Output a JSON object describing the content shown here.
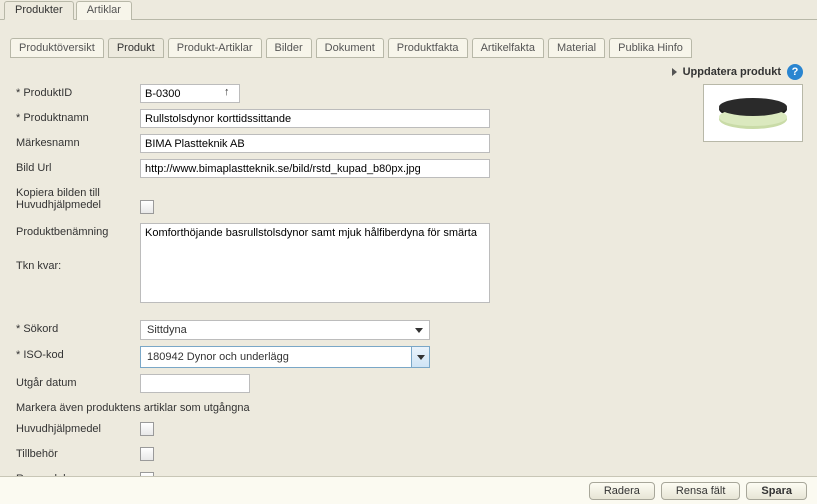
{
  "top_tabs": {
    "produkter": "Produkter",
    "artiklar": "Artiklar"
  },
  "sub_tabs": {
    "oversikt": "Produktöversikt",
    "produkt": "Produkt",
    "produkt_artiklar": "Produkt-Artiklar",
    "bilder": "Bilder",
    "dokument": "Dokument",
    "produktfakta": "Produktfakta",
    "artikelfakta": "Artikelfakta",
    "material": "Material",
    "publika_hinfo": "Publika Hinfo"
  },
  "uppdatera": "Uppdatera produkt",
  "labels": {
    "produktID": "ProduktID",
    "produktnamn": "Produktnamn",
    "markesnamn": "Märkesnamn",
    "bild_url": "Bild Url",
    "kopiera": "Kopiera bilden till Huvudhjälpmedel",
    "produktbenamning": "Produktbenämning",
    "tkn_kvar": "Tkn kvar:",
    "sokord": "Sökord",
    "iso_kod": "ISO-kod",
    "utgar_datum": "Utgår datum",
    "markera": "Markera även produktens artiklar som utgångna",
    "huvudhjalpmedel": "Huvudhjälpmedel",
    "tillbehor": "Tillbehör",
    "reservdelar": "Reservdelar"
  },
  "values": {
    "produktID": "B-0300",
    "produktnamn": "Rullstolsdynor korttidssittande",
    "markesnamn": "BIMA Plastteknik AB",
    "bild_url": "http://www.bimaplastteknik.se/bild/rstd_kupad_b80px.jpg",
    "produktbenamning": "Komforthöjande basrullstolsdynor samt mjuk hålfiberdyna för smärta",
    "sokord": "Sittdyna",
    "iso_kod": "180942 Dynor och underlägg",
    "utgar_datum": ""
  },
  "buttons": {
    "radera": "Radera",
    "rensa": "Rensa fält",
    "spara": "Spara"
  }
}
